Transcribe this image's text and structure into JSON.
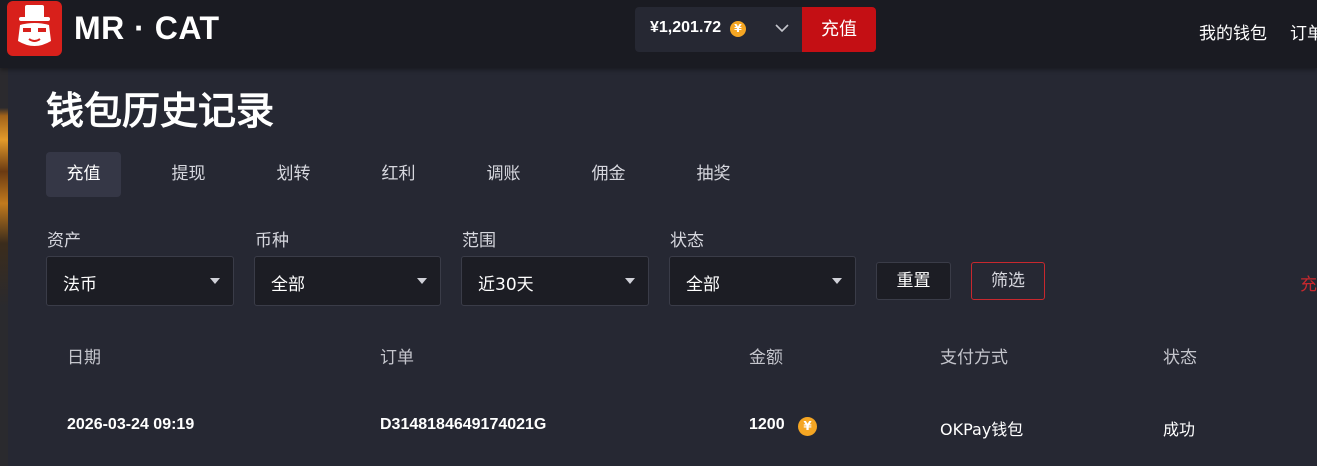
{
  "header": {
    "brand": "MR · CAT",
    "balance": "¥1,201.72",
    "coin_icon": "yuan-coin-icon",
    "recharge_label": "充值",
    "nav": [
      "我的钱包",
      "订单"
    ]
  },
  "page": {
    "title": "钱包历史记录"
  },
  "tabs": [
    {
      "label": "充值",
      "active": true
    },
    {
      "label": "提现",
      "active": false
    },
    {
      "label": "划转",
      "active": false
    },
    {
      "label": "红利",
      "active": false
    },
    {
      "label": "调账",
      "active": false
    },
    {
      "label": "佣金",
      "active": false
    },
    {
      "label": "抽奖",
      "active": false
    }
  ],
  "filters": {
    "asset": {
      "label": "资产",
      "value": "法币"
    },
    "currency": {
      "label": "币种",
      "value": "全部"
    },
    "range": {
      "label": "范围",
      "value": "近30天"
    },
    "status": {
      "label": "状态",
      "value": "全部"
    },
    "reset_label": "重置",
    "filter_label": "筛选",
    "right_edge_text": "充"
  },
  "table": {
    "columns": [
      "日期",
      "订单",
      "金额",
      "支付方式",
      "状态"
    ],
    "rows": [
      {
        "date": "2026-03-24 09:19",
        "order": "D3148184649174021G",
        "amount": "1200",
        "method": "OKPay钱包",
        "status": "成功"
      }
    ]
  },
  "colors": {
    "accent_red": "#c40f14",
    "coin_gold": "#f5a623",
    "panel_bg": "#262833",
    "topbar_bg": "#1a1b22"
  }
}
